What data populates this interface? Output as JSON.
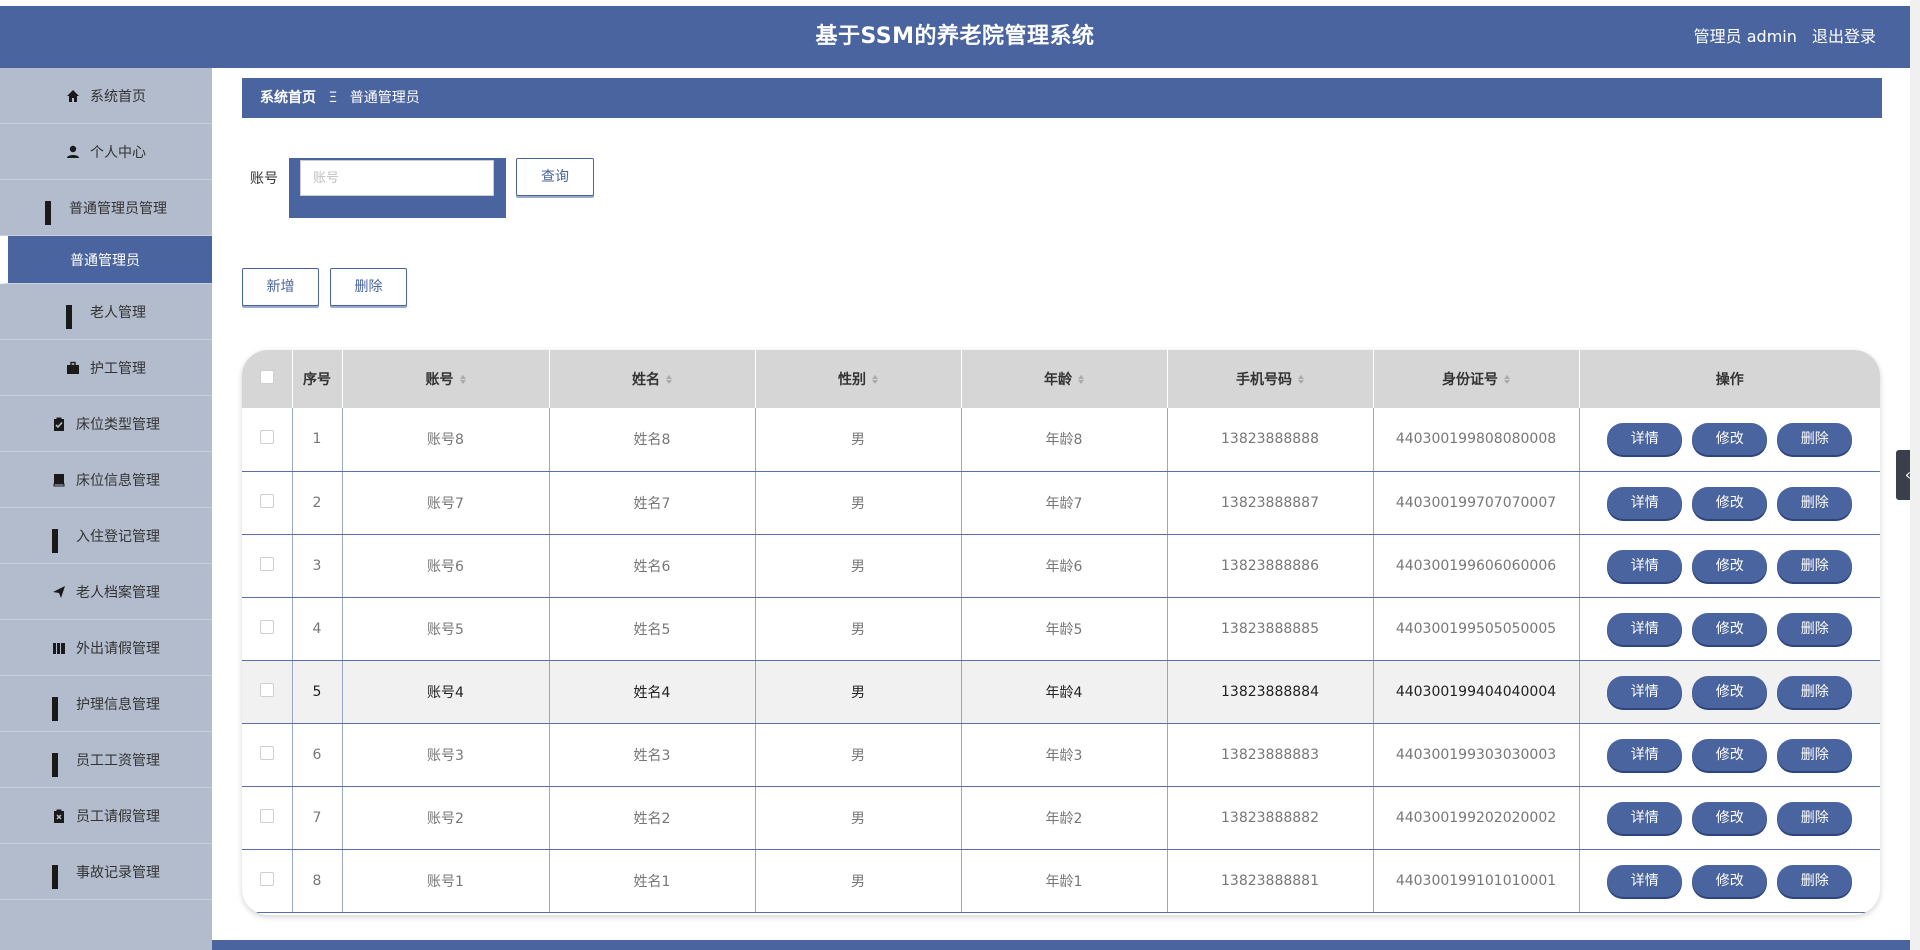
{
  "header": {
    "title": "基于SSM的养老院管理系统",
    "user_label": "管理员 admin",
    "logout_label": "退出登录"
  },
  "sidebar": {
    "items": [
      {
        "label": "系统首页",
        "icon": "home-icon"
      },
      {
        "label": "个人中心",
        "icon": "user-icon"
      },
      {
        "label": "普通管理员管理",
        "icon": "grid-icon"
      },
      {
        "label": "普通管理员",
        "icon": "",
        "active": true
      },
      {
        "label": "老人管理",
        "icon": "grid-icon"
      },
      {
        "label": "护工管理",
        "icon": "briefcase-icon"
      },
      {
        "label": "床位类型管理",
        "icon": "clipboard-check-icon"
      },
      {
        "label": "床位信息管理",
        "icon": "book-icon"
      },
      {
        "label": "入住登记管理",
        "icon": "grid-icon"
      },
      {
        "label": "老人档案管理",
        "icon": "paper-plane-icon"
      },
      {
        "label": "外出请假管理",
        "icon": "books-icon"
      },
      {
        "label": "护理信息管理",
        "icon": "grid-icon"
      },
      {
        "label": "员工工资管理",
        "icon": "grid-icon"
      },
      {
        "label": "员工请假管理",
        "icon": "clipboard-x-icon"
      },
      {
        "label": "事故记录管理",
        "icon": "grid-icon"
      }
    ]
  },
  "breadcrumb": {
    "home": "系统首页",
    "separator": "Ξ",
    "current": "普通管理员"
  },
  "search": {
    "label": "账号",
    "placeholder": "账号",
    "query_button": "查询"
  },
  "actions": {
    "add": "新增",
    "delete": "删除"
  },
  "table": {
    "columns": [
      "序号",
      "账号",
      "姓名",
      "性别",
      "年龄",
      "手机号码",
      "身份证号",
      "操作"
    ],
    "row_buttons": {
      "detail": "详情",
      "edit": "修改",
      "delete": "删除"
    },
    "rows": [
      {
        "no": "1",
        "account": "账号8",
        "name": "姓名8",
        "gender": "男",
        "age": "年龄8",
        "phone": "13823888888",
        "idcard": "440300199808080008"
      },
      {
        "no": "2",
        "account": "账号7",
        "name": "姓名7",
        "gender": "男",
        "age": "年龄7",
        "phone": "13823888887",
        "idcard": "440300199707070007"
      },
      {
        "no": "3",
        "account": "账号6",
        "name": "姓名6",
        "gender": "男",
        "age": "年龄6",
        "phone": "13823888886",
        "idcard": "440300199606060006"
      },
      {
        "no": "4",
        "account": "账号5",
        "name": "姓名5",
        "gender": "男",
        "age": "年龄5",
        "phone": "13823888885",
        "idcard": "440300199505050005"
      },
      {
        "no": "5",
        "account": "账号4",
        "name": "姓名4",
        "gender": "男",
        "age": "年龄4",
        "phone": "13823888884",
        "idcard": "440300199404040004"
      },
      {
        "no": "6",
        "account": "账号3",
        "name": "姓名3",
        "gender": "男",
        "age": "年龄3",
        "phone": "13823888883",
        "idcard": "440300199303030003"
      },
      {
        "no": "7",
        "account": "账号2",
        "name": "姓名2",
        "gender": "男",
        "age": "年龄2",
        "phone": "13823888882",
        "idcard": "440300199202020002"
      },
      {
        "no": "8",
        "account": "账号1",
        "name": "姓名1",
        "gender": "男",
        "age": "年龄1",
        "phone": "13823888881",
        "idcard": "440300199101010001"
      }
    ]
  },
  "colors": {
    "primary": "#4a64a0",
    "sidebar_bg": "#b3bccd",
    "table_header": "#d6d6d6"
  }
}
